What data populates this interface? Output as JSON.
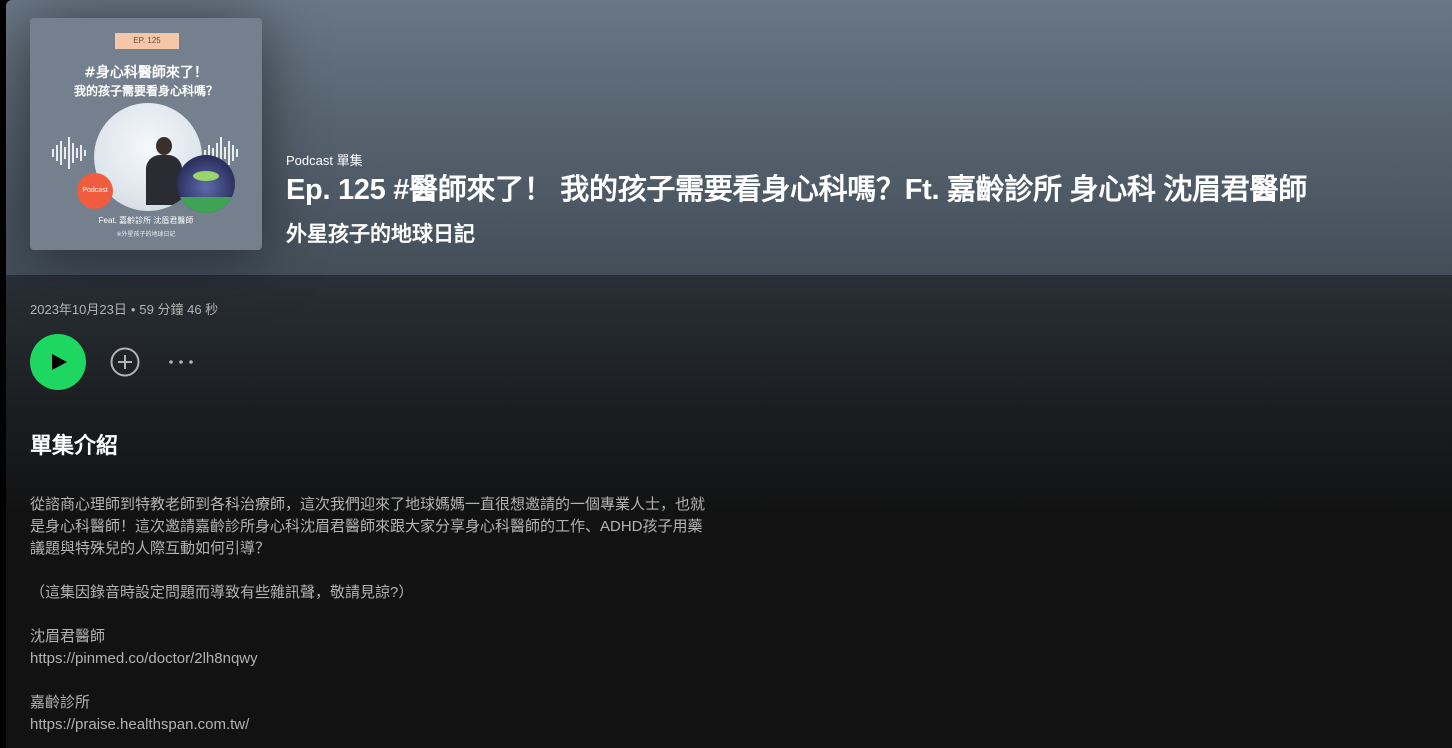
{
  "colors": {
    "accent": "#1ed760",
    "background": "#121212",
    "header_top": "#6a7886",
    "header_bottom": "#434e59",
    "text_primary": "#ffffff",
    "text_secondary": "#b3b3b3"
  },
  "cover": {
    "episode_tag": "EP. 125",
    "title_line1": "#身心科醫師來了！",
    "title_line2": "我的孩子需要看身心科嗎？",
    "badge": "Podcast",
    "feat": "Feat. 嘉齡診所 沈眉君醫師",
    "show_credit": "※外星孩子的地球日記"
  },
  "header": {
    "kind_label": "Podcast 單集",
    "episode_title": "Ep. 125 #醫師來了！ 我的孩子需要看身心科嗎？Ft. 嘉齡診所 身心科 沈眉君醫師",
    "show_name": "外星孩子的地球日記"
  },
  "meta": {
    "date": "2023年10月23日",
    "separator": "•",
    "duration": "59 分鐘 46 秒"
  },
  "actions": {
    "play_icon": "play-icon",
    "add_icon": "add-circle-icon",
    "more_icon": "more-horizontal-icon"
  },
  "description": {
    "heading": "單集介紹",
    "intro": "從諮商心理師到特教老師到各科治療師，這次我們迎來了地球媽媽一直很想邀請的一個專業人士，也就是身心科醫師！這次邀請嘉齡診所身心科沈眉君醫師來跟大家分享身心科醫師的工作、ADHD孩子用藥議題與特殊兒的人際互動如何引導？",
    "note": "（這集因錄音時設定問題而導致有些雜訊聲，敬請見諒?）",
    "doctor_name": "沈眉君醫師",
    "doctor_url": "https://pinmed.co/doctor/2lh8nqwy",
    "clinic_name": "嘉齡診所",
    "clinic_url": "https://praise.healthspan.com.tw/"
  }
}
